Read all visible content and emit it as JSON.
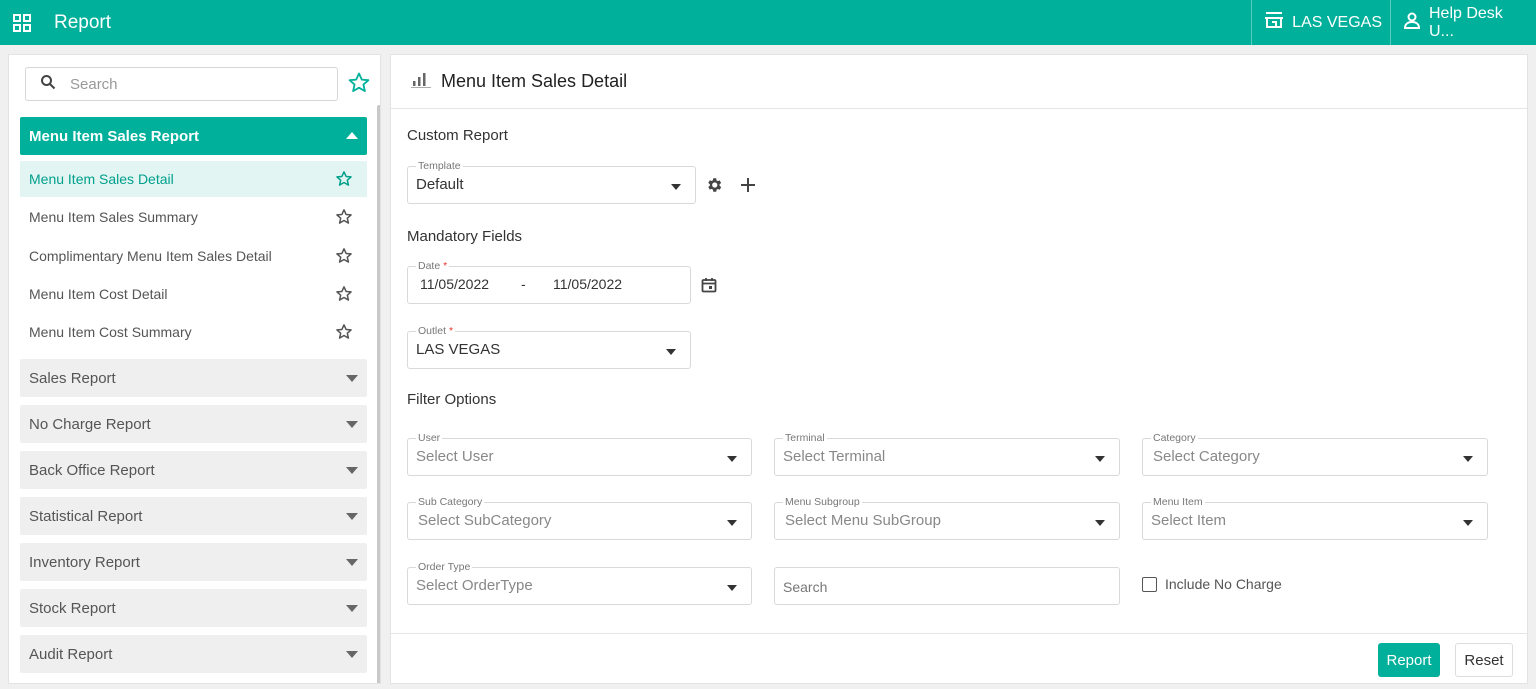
{
  "header": {
    "title": "Report",
    "outlet": "LAS VEGAS",
    "user": "Help Desk U..."
  },
  "sidebar": {
    "search_placeholder": "Search",
    "active_group": "Menu Item Sales Report",
    "active_items": [
      {
        "label": "Menu Item Sales Detail"
      },
      {
        "label": "Menu Item Sales Summary"
      },
      {
        "label": "Complimentary Menu Item Sales Detail"
      },
      {
        "label": "Menu Item Cost Detail"
      },
      {
        "label": "Menu Item Cost Summary"
      }
    ],
    "groups": [
      {
        "label": "Sales Report"
      },
      {
        "label": "No Charge Report"
      },
      {
        "label": "Back Office Report"
      },
      {
        "label": "Statistical Report"
      },
      {
        "label": "Inventory Report"
      },
      {
        "label": "Stock Report"
      },
      {
        "label": "Audit Report"
      }
    ]
  },
  "main": {
    "title": "Menu Item Sales Detail",
    "custom_report": {
      "heading": "Custom Report",
      "template_label": "Template",
      "template_value": "Default"
    },
    "mandatory": {
      "heading": "Mandatory Fields",
      "date_label": "Date",
      "date_from": "11/05/2022",
      "date_sep": "-",
      "date_to": "11/05/2022",
      "outlet_label": "Outlet",
      "outlet_value": "LAS VEGAS",
      "required_mark": "*"
    },
    "filters": {
      "heading": "Filter Options",
      "user_label": "User",
      "user_ph": "Select User",
      "terminal_label": "Terminal",
      "terminal_ph": "Select Terminal",
      "category_label": "Category",
      "category_ph": "Select Category",
      "subcategory_label": "Sub Category",
      "subcategory_ph": "Select SubCategory",
      "subgroup_label": "Menu Subgroup",
      "subgroup_ph": "Select Menu SubGroup",
      "item_label": "Menu Item",
      "item_ph": "Select Item",
      "ordertype_label": "Order Type",
      "ordertype_ph": "Select OrderType",
      "search_ph": "Search",
      "include_no_charge": "Include No Charge"
    },
    "actions": {
      "report": "Report",
      "reset": "Reset"
    }
  },
  "colors": {
    "accent": "#00b09b",
    "active_item_bg": "#e2f5f2",
    "required": "#e53935"
  }
}
